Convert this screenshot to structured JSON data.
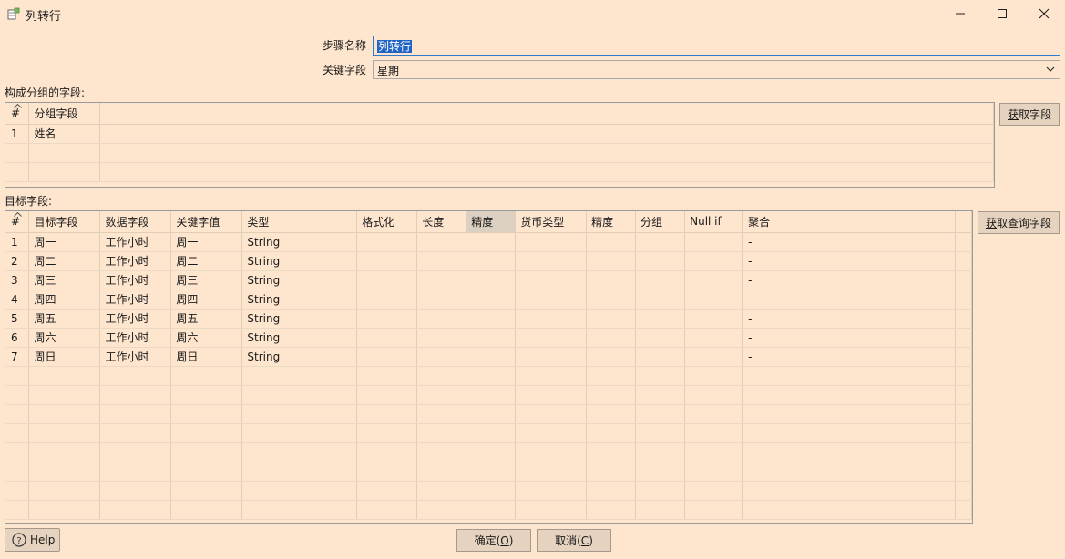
{
  "window": {
    "title": "列转行",
    "icon": "table-transform-icon"
  },
  "form": {
    "step_name_label": "步骤名称",
    "step_name_value": "列转行",
    "key_field_label": "关键字段",
    "key_field_value": "星期"
  },
  "group_section": {
    "label": "构成分组的字段:",
    "columns": [
      "#",
      "分组字段"
    ],
    "rows": [
      [
        "1",
        "姓名"
      ]
    ],
    "get_fields_button": {
      "accel": "获",
      "rest": "取字段"
    }
  },
  "target_section": {
    "label": "目标字段:",
    "columns": [
      "#",
      "目标字段",
      "数据字段",
      "关键字值",
      "类型",
      "格式化",
      "长度",
      "精度",
      "货币类型",
      "精度",
      "分组",
      "Null if",
      "聚合"
    ],
    "rows": [
      [
        "1",
        "周一",
        "工作小时",
        "周一",
        "String",
        "",
        "",
        "",
        "",
        "",
        "",
        "",
        "-"
      ],
      [
        "2",
        "周二",
        "工作小时",
        "周二",
        "String",
        "",
        "",
        "",
        "",
        "",
        "",
        "",
        "-"
      ],
      [
        "3",
        "周三",
        "工作小时",
        "周三",
        "String",
        "",
        "",
        "",
        "",
        "",
        "",
        "",
        "-"
      ],
      [
        "4",
        "周四",
        "工作小时",
        "周四",
        "String",
        "",
        "",
        "",
        "",
        "",
        "",
        "",
        "-"
      ],
      [
        "5",
        "周五",
        "工作小时",
        "周五",
        "String",
        "",
        "",
        "",
        "",
        "",
        "",
        "",
        "-"
      ],
      [
        "6",
        "周六",
        "工作小时",
        "周六",
        "String",
        "",
        "",
        "",
        "",
        "",
        "",
        "",
        "-"
      ],
      [
        "7",
        "周日",
        "工作小时",
        "周日",
        "String",
        "",
        "",
        "",
        "",
        "",
        "",
        "",
        "-"
      ]
    ],
    "get_lookup_button": {
      "accel": "获",
      "rest": "取查询字段"
    }
  },
  "footer": {
    "help_label": "Help",
    "ok_label": "确定(",
    "ok_accel": "O",
    "ok_end": ")",
    "cancel_label": "取消(",
    "cancel_accel": "C",
    "cancel_end": ")"
  },
  "colors": {
    "background": "#fde5ce",
    "selection": "#1f63c4",
    "focus_border": "#2c7bd1",
    "highlight_header": "#dcd0c2"
  }
}
